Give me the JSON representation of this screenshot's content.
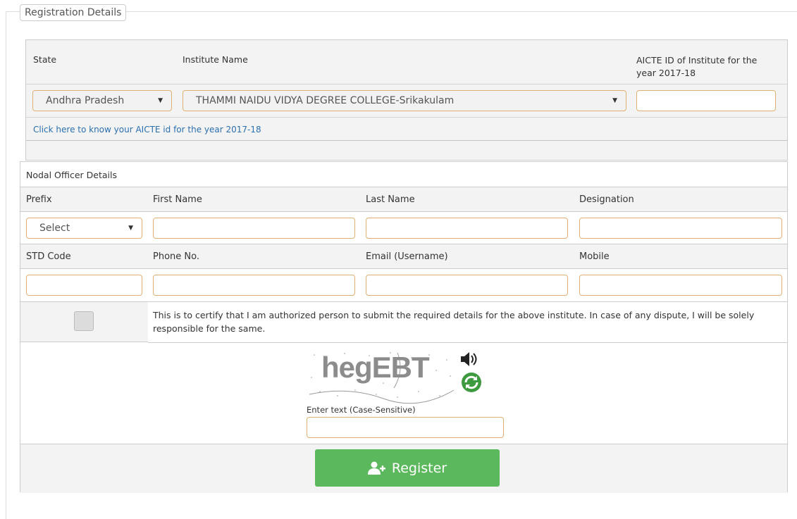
{
  "legend": "Registration Details",
  "institute": {
    "headers": {
      "state": "State",
      "institute_name": "Institute Name",
      "aicte_id": "AICTE ID of Institute for the year 2017-18"
    },
    "state_value": "Andhra Pradesh",
    "institute_value": "THAMMI NAIDU VIDYA DEGREE COLLEGE-Srikakulam",
    "aicte_value": "",
    "aicte_link": "Click here to know your AICTE id for the year 2017-18"
  },
  "nodal": {
    "title": "Nodal Officer Details",
    "row1_labels": {
      "prefix": "Prefix",
      "first_name": "First Name",
      "last_name": "Last Name",
      "designation": "Designation"
    },
    "prefix_value": "Select",
    "row2_labels": {
      "std_code": "STD Code",
      "phone": "Phone No.",
      "email": "Email (Username)",
      "mobile": "Mobile"
    },
    "certify_text": "This is to certify that I am authorized person to submit the required details for the above institute. In case of any dispute, I will be solely responsible for the same.",
    "captcha_text": "hegEBT",
    "captcha_label": "Enter text (Case-Sensitive)",
    "register_label": "Register"
  },
  "colors": {
    "accent_border": "#e0b073",
    "register_green": "#5cb85c",
    "link_blue": "#2a6fb0"
  },
  "icons": [
    "speaker-icon",
    "refresh-icon",
    "user-plus-icon",
    "chevron-down-icon"
  ]
}
